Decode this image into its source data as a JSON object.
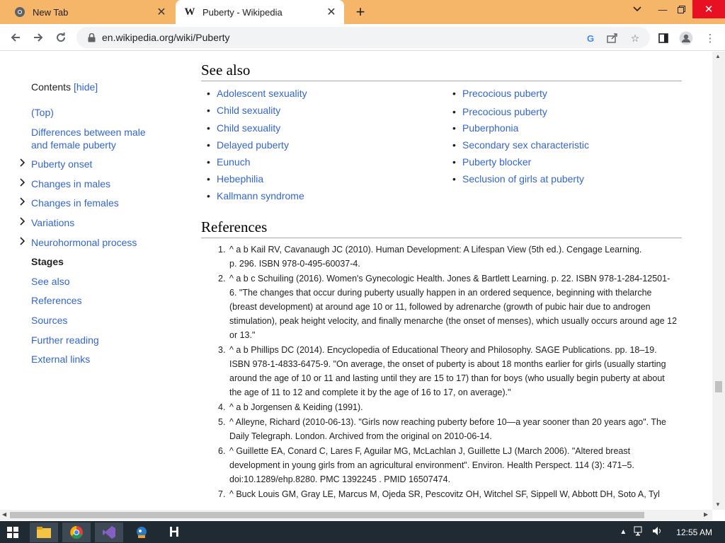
{
  "browser": {
    "tabs": [
      {
        "title": "New Tab",
        "active": false,
        "icon": "chrome-icon"
      },
      {
        "title": "Puberty - Wikipedia",
        "active": true,
        "icon": "wikipedia-icon"
      }
    ],
    "url": "en.wikipedia.org/wiki/Puberty",
    "favicon_letter": "W"
  },
  "toc": {
    "title": "Contents",
    "hide_label": "[hide]",
    "items": [
      {
        "label": "(Top)",
        "expandable": false
      },
      {
        "label": "Differences between male",
        "label2": "and female puberty",
        "expandable": false
      },
      {
        "label": "Puberty onset",
        "expandable": true
      },
      {
        "label": "Changes in males",
        "expandable": true
      },
      {
        "label": "Changes in females",
        "expandable": true
      },
      {
        "label": "Variations",
        "expandable": true
      },
      {
        "label": "Neurohormonal process",
        "expandable": true
      },
      {
        "label": "Stages",
        "expandable": false,
        "current": true
      },
      {
        "label": "See also",
        "expandable": false
      },
      {
        "label": "References",
        "expandable": false
      },
      {
        "label": "Sources",
        "expandable": false
      },
      {
        "label": "Further reading",
        "expandable": false
      },
      {
        "label": "External links",
        "expandable": false
      }
    ]
  },
  "see_also": {
    "heading": "See also",
    "left": [
      "Adolescent sexuality",
      "Child sexuality",
      "Child sexuality",
      "Delayed puberty",
      "Eunuch",
      "Hebephilia",
      "Kallmann syndrome"
    ],
    "right": [
      "Precocious puberty",
      "Precocious puberty",
      "Puberphonia",
      "Secondary sex characteristic",
      "Puberty blocker",
      "Seclusion of girls at puberty"
    ]
  },
  "references": {
    "heading": "References",
    "items": [
      {
        "n": "1.",
        "lines": [
          "^ a b Kail RV, Cavanaugh JC (2010). Human Development: A Lifespan View (5th ed.). Cengage Learning.",
          "p. 296. ISBN 978-0-495-60037-4."
        ]
      },
      {
        "n": "2.",
        "lines": [
          "^ a b c Schuiling (2016). Women's Gynecologic Health. Jones & Bartlett Learning. p. 22. ISBN 978-1-284-12501-",
          "6. \"The changes that occur during puberty usually happen in an ordered sequence, beginning with thelarche",
          "(breast development) at around age 10 or 11, followed by adrenarche (growth of pubic hair due to androgen",
          "stimulation), peak height velocity, and finally menarche (the onset of menses), which usually occurs around age 12",
          "or 13.\""
        ]
      },
      {
        "n": "3.",
        "lines": [
          "^ a b Phillips DC (2014). Encyclopedia of Educational Theory and Philosophy. SAGE Publications. pp. 18–19.",
          "ISBN 978-1-4833-6475-9. \"On average, the onset of puberty is about 18 months earlier for girls (usually starting",
          "around the age of 10 or 11 and lasting until they are 15 to 17) than for boys (who usually begin puberty at about",
          "the age of 11 to 12 and complete it by the age of 16 to 17, on average).\""
        ]
      },
      {
        "n": "4.",
        "lines": [
          "^ a b Jorgensen & Keiding (1991)."
        ]
      },
      {
        "n": "5.",
        "lines": [
          "^ Alleyne, Richard (2010-06-13). \"Girls now reaching puberty before 10—a year sooner than 20 years ago\". The",
          "Daily Telegraph. London. Archived from the original on 2010-06-14."
        ]
      },
      {
        "n": "6.",
        "lines": [
          "^ Guillette EA, Conard C, Lares F, Aguilar MG, McLachlan J, Guillette LJ (March 2006). \"Altered breast",
          "development in young girls from an agricultural environment\". Environ. Health Perspect. 114 (3): 471–5.",
          "doi:10.1289/ehp.8280. PMC 1392245 . PMID 16507474."
        ]
      },
      {
        "n": "7.",
        "lines": [
          "^ Buck Louis GM, Gray LE, Marcus M, Ojeda SR, Pescovitz OH, Witchel SF, Sippell W, Abbott DH, Soto A, Tyl"
        ]
      }
    ]
  },
  "taskbar": {
    "clock": "12:55 AM",
    "apps": [
      "file-explorer-icon",
      "chrome-icon",
      "visual-studio-icon",
      "app-icon",
      "h-app-icon"
    ]
  }
}
